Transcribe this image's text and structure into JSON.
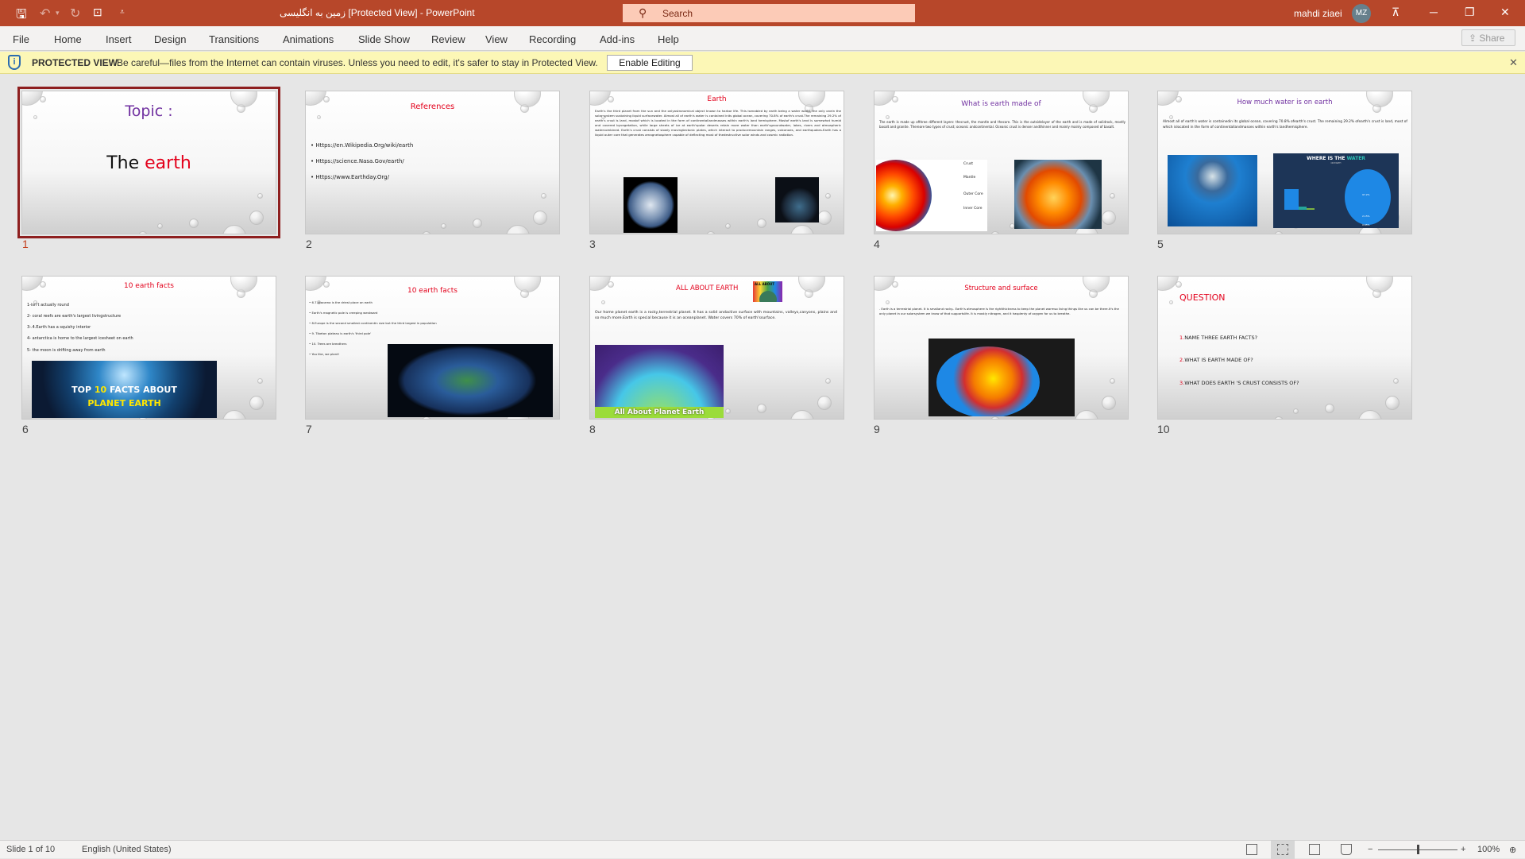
{
  "app": {
    "title": "زمین به انگلیسی [Protected View]  -  PowerPoint",
    "search_placeholder": "Search",
    "user": "mahdi ziaei",
    "avatar_initials": "MZ",
    "accent": "#b7472a"
  },
  "ribbon": {
    "tabs": [
      "File",
      "Home",
      "Insert",
      "Design",
      "Transitions",
      "Animations",
      "Slide Show",
      "Review",
      "View",
      "Recording",
      "Add-ins",
      "Help"
    ],
    "share": "Share"
  },
  "protected": {
    "label": "PROTECTED VIEW",
    "message": "Be careful—files from the Internet can contain viruses. Unless you need to edit, it's safer to stay in Protected View.",
    "button": "Enable Editing"
  },
  "slides": [
    {
      "number": "1",
      "title": "Topic :",
      "subtitle_prefix": "The ",
      "subtitle_accent": "earth",
      "selected": true
    },
    {
      "number": "2",
      "title": "References",
      "bullets": [
        "Https://en.Wikipedia.Org/wiki/earth",
        "Https://science.Nasa.Gov/earth/",
        "Https://www.Earthday.Org/"
      ]
    },
    {
      "number": "3",
      "title": "Earth",
      "paragraph": "Earth's the third planet from the sun and the onlyastronomical object known to harbor life. This isenabled by earth being a water world, the only onein the solar system sustaining liquid surfacewater. Almost all of earth's water is contained inits global ocean, covering 70.8% of earth's crust.The remaining 29.2% of earth's crust is land, mostof which is located in the form of continentallandmasses within earth's land hemisphere. Mostof earth's land is somewhat humid and covered byvegetation, while large sheets of ice at earth'spolar deserts retain more water than earth'sgroundwater, lakes, rivers and atmospheric watercombined. Earth's crust consists of slowly movingtectonic plates, which interact to producemountain ranges, volcanoes, and earthquakes.Earth has a liquid outer core that generates amagnetosphere capable of deflecting most of thedestructive solar winds and cosmic radiation."
    },
    {
      "number": "4",
      "title": "What is earth made of",
      "paragraph": "The earth is made up ofthree different layers: thecrust, the mantle and thecore. This is the outsidelayer of the earth and is made of solidrock, mostly basalt and granite. Thereare two types of crust; oceanic andcontinental. Oceanic crust is denser andthinner and mainly mainly composed of basalt.",
      "labels": [
        "Crust",
        "Mantle",
        "Outer Core",
        "Inner Core"
      ]
    },
    {
      "number": "5",
      "title": "How much water is on earth",
      "paragraph": "Almost all of earth's water is containedin its global ocean, covering 70.8% ofearth's crust. The remaining 29.2% ofearth's crust is land, most of which islocated in the form of continentallandmasses within earth's landhemisphere.",
      "infographic_title": "WHERE IS THE ",
      "infographic_accent": "WATER",
      "infographic_sub": "ON EARTH",
      "infographic_values": [
        "97.2%",
        "2.15%",
        "0.65%"
      ]
    },
    {
      "number": "6",
      "title": "10 earth facts",
      "lines": [
        "1-isn't actually round",
        "2- coral reefs are earth's largest livingstructure",
        "3-.4.Earth has a squishy interior",
        "4- antarctica is home to the largest icesheet on earth",
        "5- the moon is drifting away from earth"
      ],
      "banner_line1_a": "TOP ",
      "banner_line1_b": "10",
      "banner_line1_c": " FACTS ABOUT",
      "banner_line2": "PLANET EARTH"
    },
    {
      "number": "7",
      "title": "10 earth facts",
      "bullets": [
        "6.7.Atacama is the driest place on earth",
        "Earth's magnetic pole is creeping westward",
        "8.Europe is the second smallest continentin size but the third largest in population",
        "9. Tibetan plateau is earth's 'third pole'",
        "10. Trees are breathers",
        "You like, we plant!"
      ]
    },
    {
      "number": "8",
      "title": "ALL ABOUT EARTH",
      "logo_text": "ALL ABOUT",
      "paragraph": "Our home planet earth is a rocky,terrestrial planet. It has a solid andactive surface with mountains, valleys,canyons, plains and so much more.Earth is special because it is an oceanplanet. Water covers 70% of earth'ssurface.",
      "banner": "All About Planet Earth"
    },
    {
      "number": "9",
      "title": "Structure and surface",
      "paragraph": ". Earth is a terrestrial planet. It is smalland rocky.. Earth's atmosphere is the rightthickness to keep the planet warmso living things like us can be there.It's the only planet in our solarsystem we know of that supportslife. It is mostly nitrogen, and it hasplenty of oxygen for us to breathe."
    },
    {
      "number": "10",
      "title": "QUESTION",
      "questions": [
        {
          "n": "1.",
          "t": "NAME THREE EARTH FACTS?"
        },
        {
          "n": "2.",
          "t": "WHAT IS EARTH MADE OF?"
        },
        {
          "n": "3.",
          "t": "WHAT DOES EARTH 'S CRUST  CONSISTS OF?"
        }
      ]
    }
  ],
  "colors": {
    "title_red": "#e3001b",
    "title_purple": "#7030a0",
    "selection": "#8e1f1f"
  },
  "status": {
    "slide_info": "Slide 1 of 10",
    "language": "English (United States)",
    "zoom": "100%",
    "zoom_level_percent": 100
  }
}
